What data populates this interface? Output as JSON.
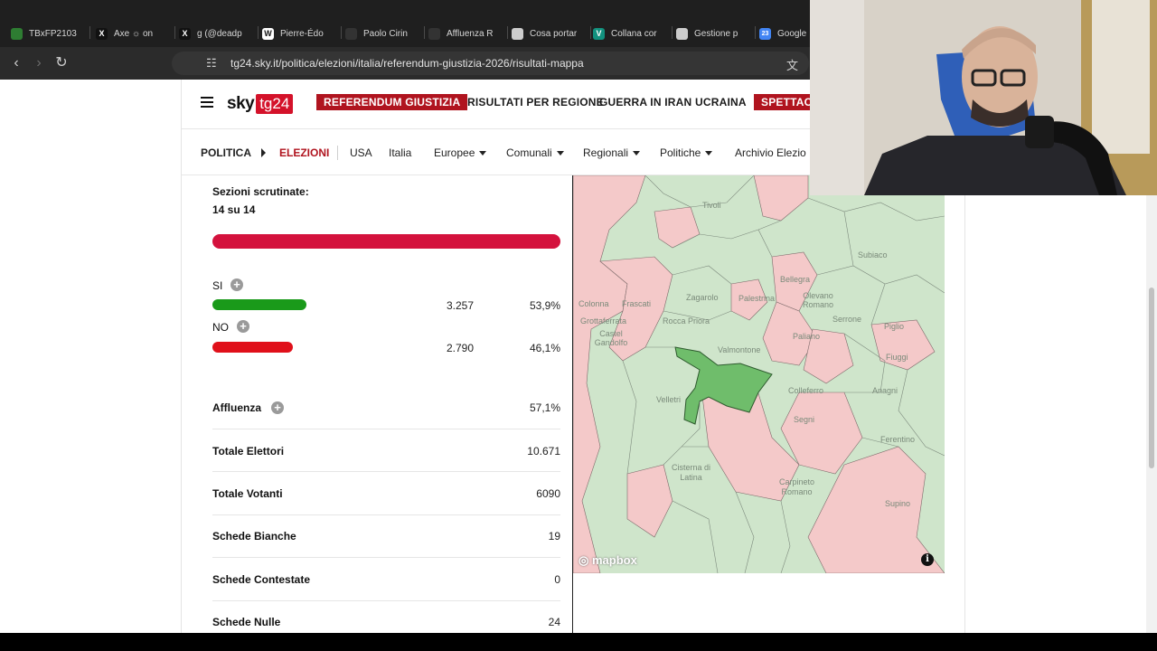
{
  "browser": {
    "tabs": [
      {
        "label": "TBxFP2103",
        "icon_color": "#2e7d32",
        "icon": "drive-icon"
      },
      {
        "label": "Axe ☼ on",
        "icon_color": "#111111",
        "icon": "x-icon"
      },
      {
        "label": "g (@deadp",
        "icon_color": "#111111",
        "icon": "x-icon"
      },
      {
        "label": "Pierre-Édo",
        "icon_color": "#ffffff",
        "icon": "wikipedia-icon"
      },
      {
        "label": "Paolo Cirin",
        "icon_color": "#333333",
        "icon": "page-icon"
      },
      {
        "label": "Affluenza R",
        "icon_color": "#333333",
        "icon": "page-icon"
      },
      {
        "label": "Cosa portar",
        "icon_color": "#cccccc",
        "icon": "chatgpt-icon"
      },
      {
        "label": "Collana cor",
        "icon_color": "#12917e",
        "icon": "v-icon"
      },
      {
        "label": "Gestione p",
        "icon_color": "#cccccc",
        "icon": "chatgpt-icon"
      },
      {
        "label": "Google",
        "icon_color": "#4285f4",
        "icon": "calendar-icon"
      }
    ],
    "url": "tg24.sky.it/politica/elezioni/italia/referendum-giustizia-2026/risultati-mappa"
  },
  "header": {
    "logo_sky": "sky",
    "logo_tg": "tg24",
    "nav": [
      {
        "label": "REFERENDUM GIUSTIZIA",
        "highlight": true
      },
      {
        "label": "RISULTATI PER REGIONE",
        "highlight": false
      },
      {
        "label": "GUERRA IN IRAN",
        "highlight": false
      },
      {
        "label": "UCRAINA",
        "highlight": false
      },
      {
        "label": "SPETTACO",
        "highlight": true
      }
    ]
  },
  "subnav": {
    "section": "POLITICA",
    "active": "ELEZIONI",
    "items": [
      "USA",
      "Italia",
      "Europee",
      "Comunali",
      "Regionali",
      "Politiche",
      "Archivio Elezio"
    ]
  },
  "results": {
    "sezioni_label": "Sezioni scrutinate:",
    "sezioni_value": "14 su 14",
    "sezioni_progress": 1.0,
    "si": {
      "label": "SI",
      "votes": "3.257",
      "percent": "53,9%",
      "color": "#1a9a1a",
      "fraction": 0.539
    },
    "no": {
      "label": "NO",
      "votes": "2.790",
      "percent": "46,1%",
      "color": "#e0101a",
      "fraction": 0.461
    },
    "stats": [
      {
        "label": "Affluenza",
        "value": "57,1%",
        "expandable": true
      },
      {
        "label": "Totale Elettori",
        "value": "10.671",
        "expandable": false
      },
      {
        "label": "Totale Votanti",
        "value": "6090",
        "expandable": false
      },
      {
        "label": "Schede Bianche",
        "value": "19",
        "expandable": false
      },
      {
        "label": "Schede Contestate",
        "value": "0",
        "expandable": false
      },
      {
        "label": "Schede Nulle",
        "value": "24",
        "expandable": false
      }
    ]
  },
  "map": {
    "colors": {
      "si": "#cfe5cb",
      "no": "#f4c9c9",
      "selected": "#6fbd6b"
    },
    "labels": [
      "Tivoli",
      "Subiaco",
      "Bellegra",
      "Olevano Romano",
      "Zagarolo",
      "Palestrina",
      "Serrone",
      "Piglio",
      "Colonna",
      "Frascati",
      "Rocca Priora",
      "Grottaferrata",
      "Paliano",
      "Valmontone",
      "Castel Gandolfo",
      "Fiuggi",
      "Velletri",
      "Colleferro",
      "Anagni",
      "Segni",
      "Ferentino",
      "Cisterna di Latina",
      "Carpineto Romano",
      "Supino"
    ],
    "attribution": "mapbox"
  }
}
